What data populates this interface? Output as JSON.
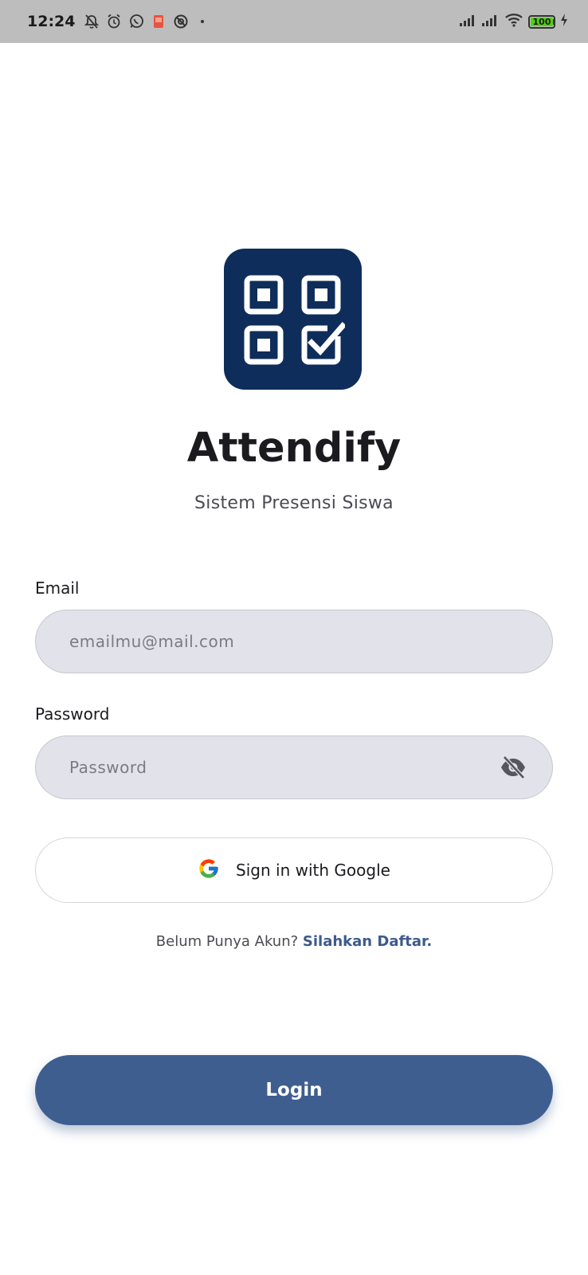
{
  "status_bar": {
    "time": "12:24",
    "battery_level": "100",
    "left_icons": [
      "bell-off-icon",
      "alarm-icon",
      "whatsapp-icon",
      "play-store-icon",
      "vpn-icon"
    ],
    "right_icons": [
      "signal-icon",
      "signal-icon",
      "wifi-icon",
      "battery-icon",
      "charging-icon"
    ]
  },
  "app": {
    "name": "Attendify",
    "subtitle": "Sistem Presensi Siswa",
    "logo_color": "#0e2d5a"
  },
  "form": {
    "email_label": "Email",
    "email_placeholder": "emailmu@mail.com",
    "email_value": "",
    "password_label": "Password",
    "password_placeholder": "Password",
    "password_value": "",
    "password_visibility_icon": "eye-off-icon"
  },
  "google_button": {
    "label": "Sign in with Google",
    "icon": "google-icon"
  },
  "register": {
    "prompt": "Belum Punya Akun?",
    "link": "Silahkan Daftar."
  },
  "login_button": {
    "label": "Login",
    "color": "#3f5e90"
  },
  "colors": {
    "status_bar_bg": "#bdbdbd",
    "input_bg": "#e1e2ea",
    "link": "#3d5a8c"
  }
}
